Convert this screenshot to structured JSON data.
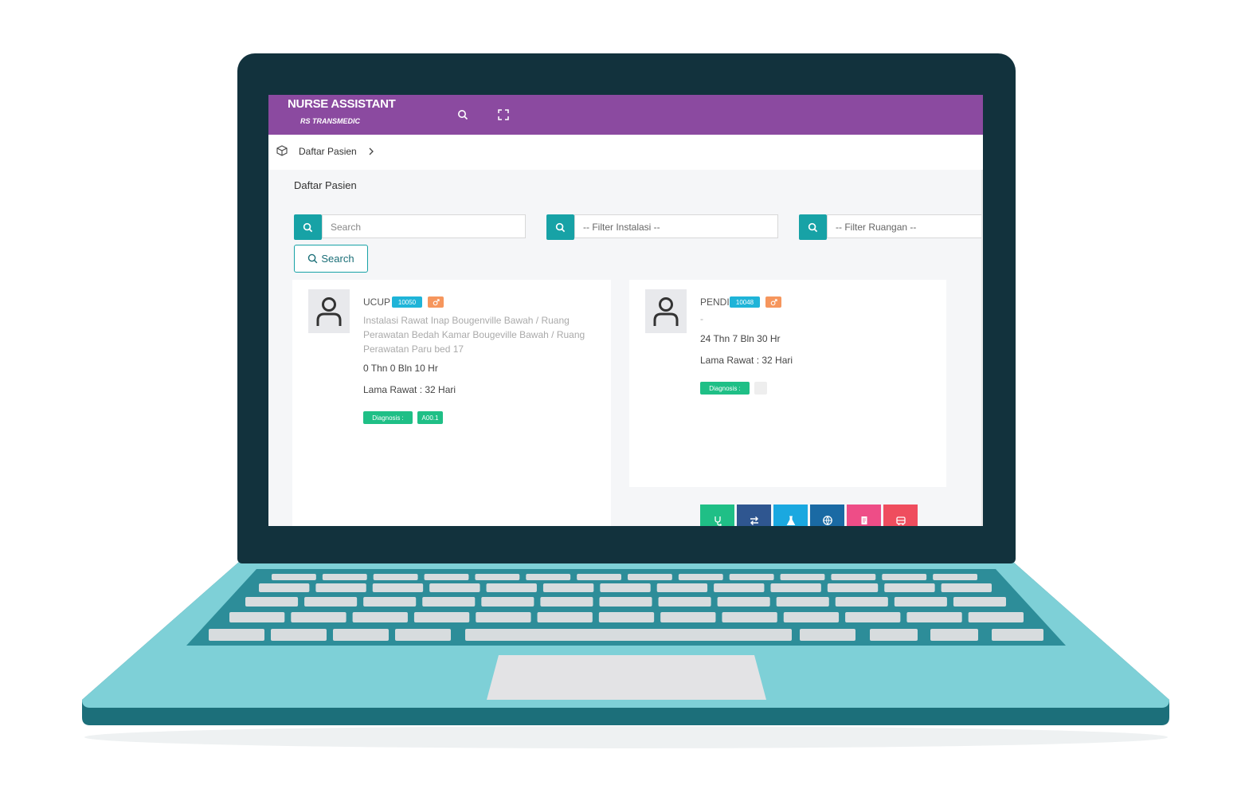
{
  "app": {
    "title": "NURSE ASSISTANT",
    "subtitle": "RS TRANSMEDIC",
    "header_color": "#8b4aa0",
    "accent_color": "#17a2a6"
  },
  "header": {
    "icons": [
      "search-icon",
      "fullscreen-icon"
    ]
  },
  "breadcrumb": {
    "icon": "box-icon",
    "label": "Daftar Pasien"
  },
  "page": {
    "title": "Daftar Pasien"
  },
  "filters": {
    "search": {
      "placeholder": "Search",
      "value": ""
    },
    "instalasi": {
      "placeholder": "-- Filter Instalasi --"
    },
    "ruangan": {
      "placeholder": "-- Filter Ruangan --"
    },
    "search_button": "Search"
  },
  "patients": [
    {
      "name": "UCUP",
      "id": "10050",
      "gender_icon": "male-icon",
      "location": "Instalasi Rawat Inap Bougenville Bawah / Ruang Perawatan Bedah Kamar Bougeville Bawah / Ruang Perawatan Paru bed 17",
      "age": "0 Thn 0 Bln 10 Hr",
      "stay": "Lama Rawat : 32 Hari",
      "diagnosis_label": "Diagnosis :",
      "diagnosis_code": "A00.1"
    },
    {
      "name": "PENDI",
      "id": "10048",
      "gender_icon": "male-icon",
      "location": "-",
      "age": "24 Thn 7 Bln 30 Hr",
      "stay": "Lama Rawat : 32 Hari",
      "diagnosis_label": "Diagnosis :",
      "diagnosis_code": ""
    }
  ],
  "actions": [
    {
      "icon": "stethoscope-icon",
      "color": "#1fbf86"
    },
    {
      "icon": "transfer-icon",
      "color": "#2f5690"
    },
    {
      "icon": "lab-flask-icon",
      "color": "#1aa8e0"
    },
    {
      "icon": "globe-icon",
      "color": "#1a6aa4"
    },
    {
      "icon": "document-icon",
      "color": "#ee4d87"
    },
    {
      "icon": "ambulance-icon",
      "color": "#ef4d5e"
    },
    {
      "icon": "medicine-bag-icon",
      "color": "#2f5690"
    },
    {
      "icon": "history-icon",
      "color": "#f6965d"
    }
  ]
}
